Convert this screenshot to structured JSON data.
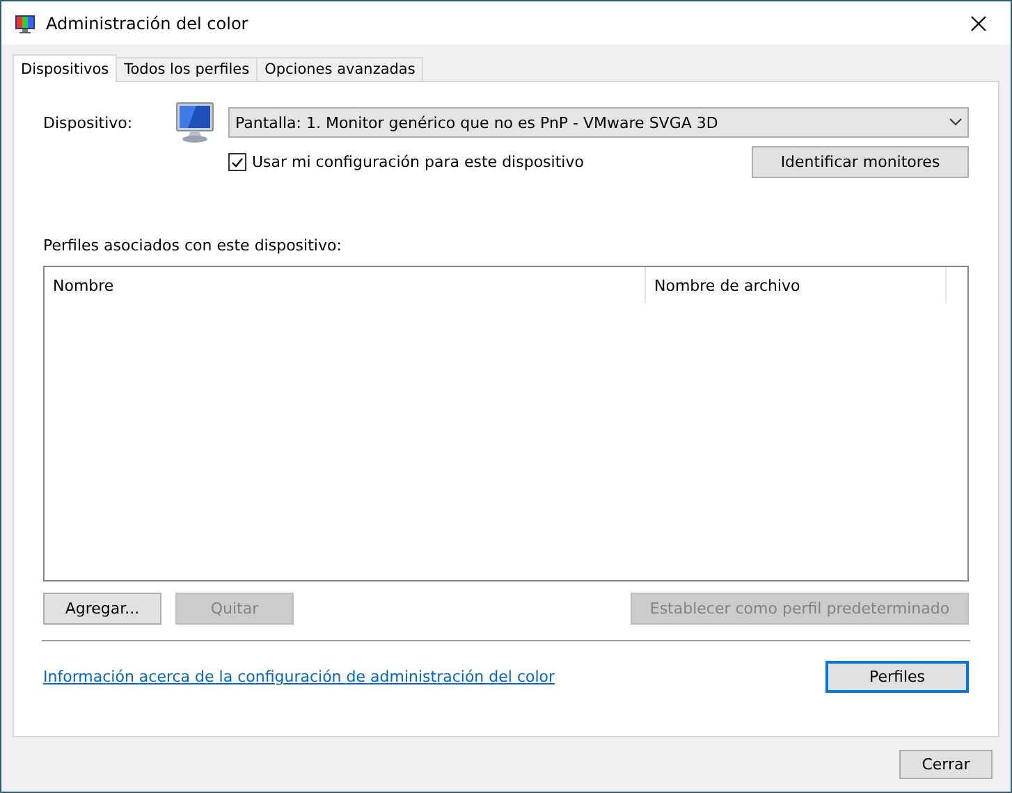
{
  "window": {
    "title": "Administración del color"
  },
  "tabs": [
    {
      "label": "Dispositivos",
      "selected": true
    },
    {
      "label": "Todos los perfiles",
      "selected": false
    },
    {
      "label": "Opciones avanzadas",
      "selected": false
    }
  ],
  "device": {
    "label": "Dispositivo:",
    "value": "Pantalla: 1. Monitor genérico que no es PnP - VMware SVGA 3D"
  },
  "use_my_settings": {
    "label": "Usar mi configuración para este dispositivo",
    "checked": true
  },
  "identify_button": {
    "label": "Identificar monitores",
    "disabled": false
  },
  "profiles_label": "Perfiles asociados con este dispositivo:",
  "table": {
    "columns": [
      "Nombre",
      "Nombre de archivo"
    ]
  },
  "action_buttons": [
    {
      "label": "Agregar...",
      "disabled": false
    },
    {
      "label": "Quitar",
      "disabled": true
    },
    {
      "label": "Establecer como perfil predeterminado",
      "disabled": true
    }
  ],
  "info_link": "Información acerca de la configuración de administración del color",
  "profiles_button": {
    "label": "Perfiles",
    "focused": true
  },
  "close_button": {
    "label": "Cerrar"
  }
}
